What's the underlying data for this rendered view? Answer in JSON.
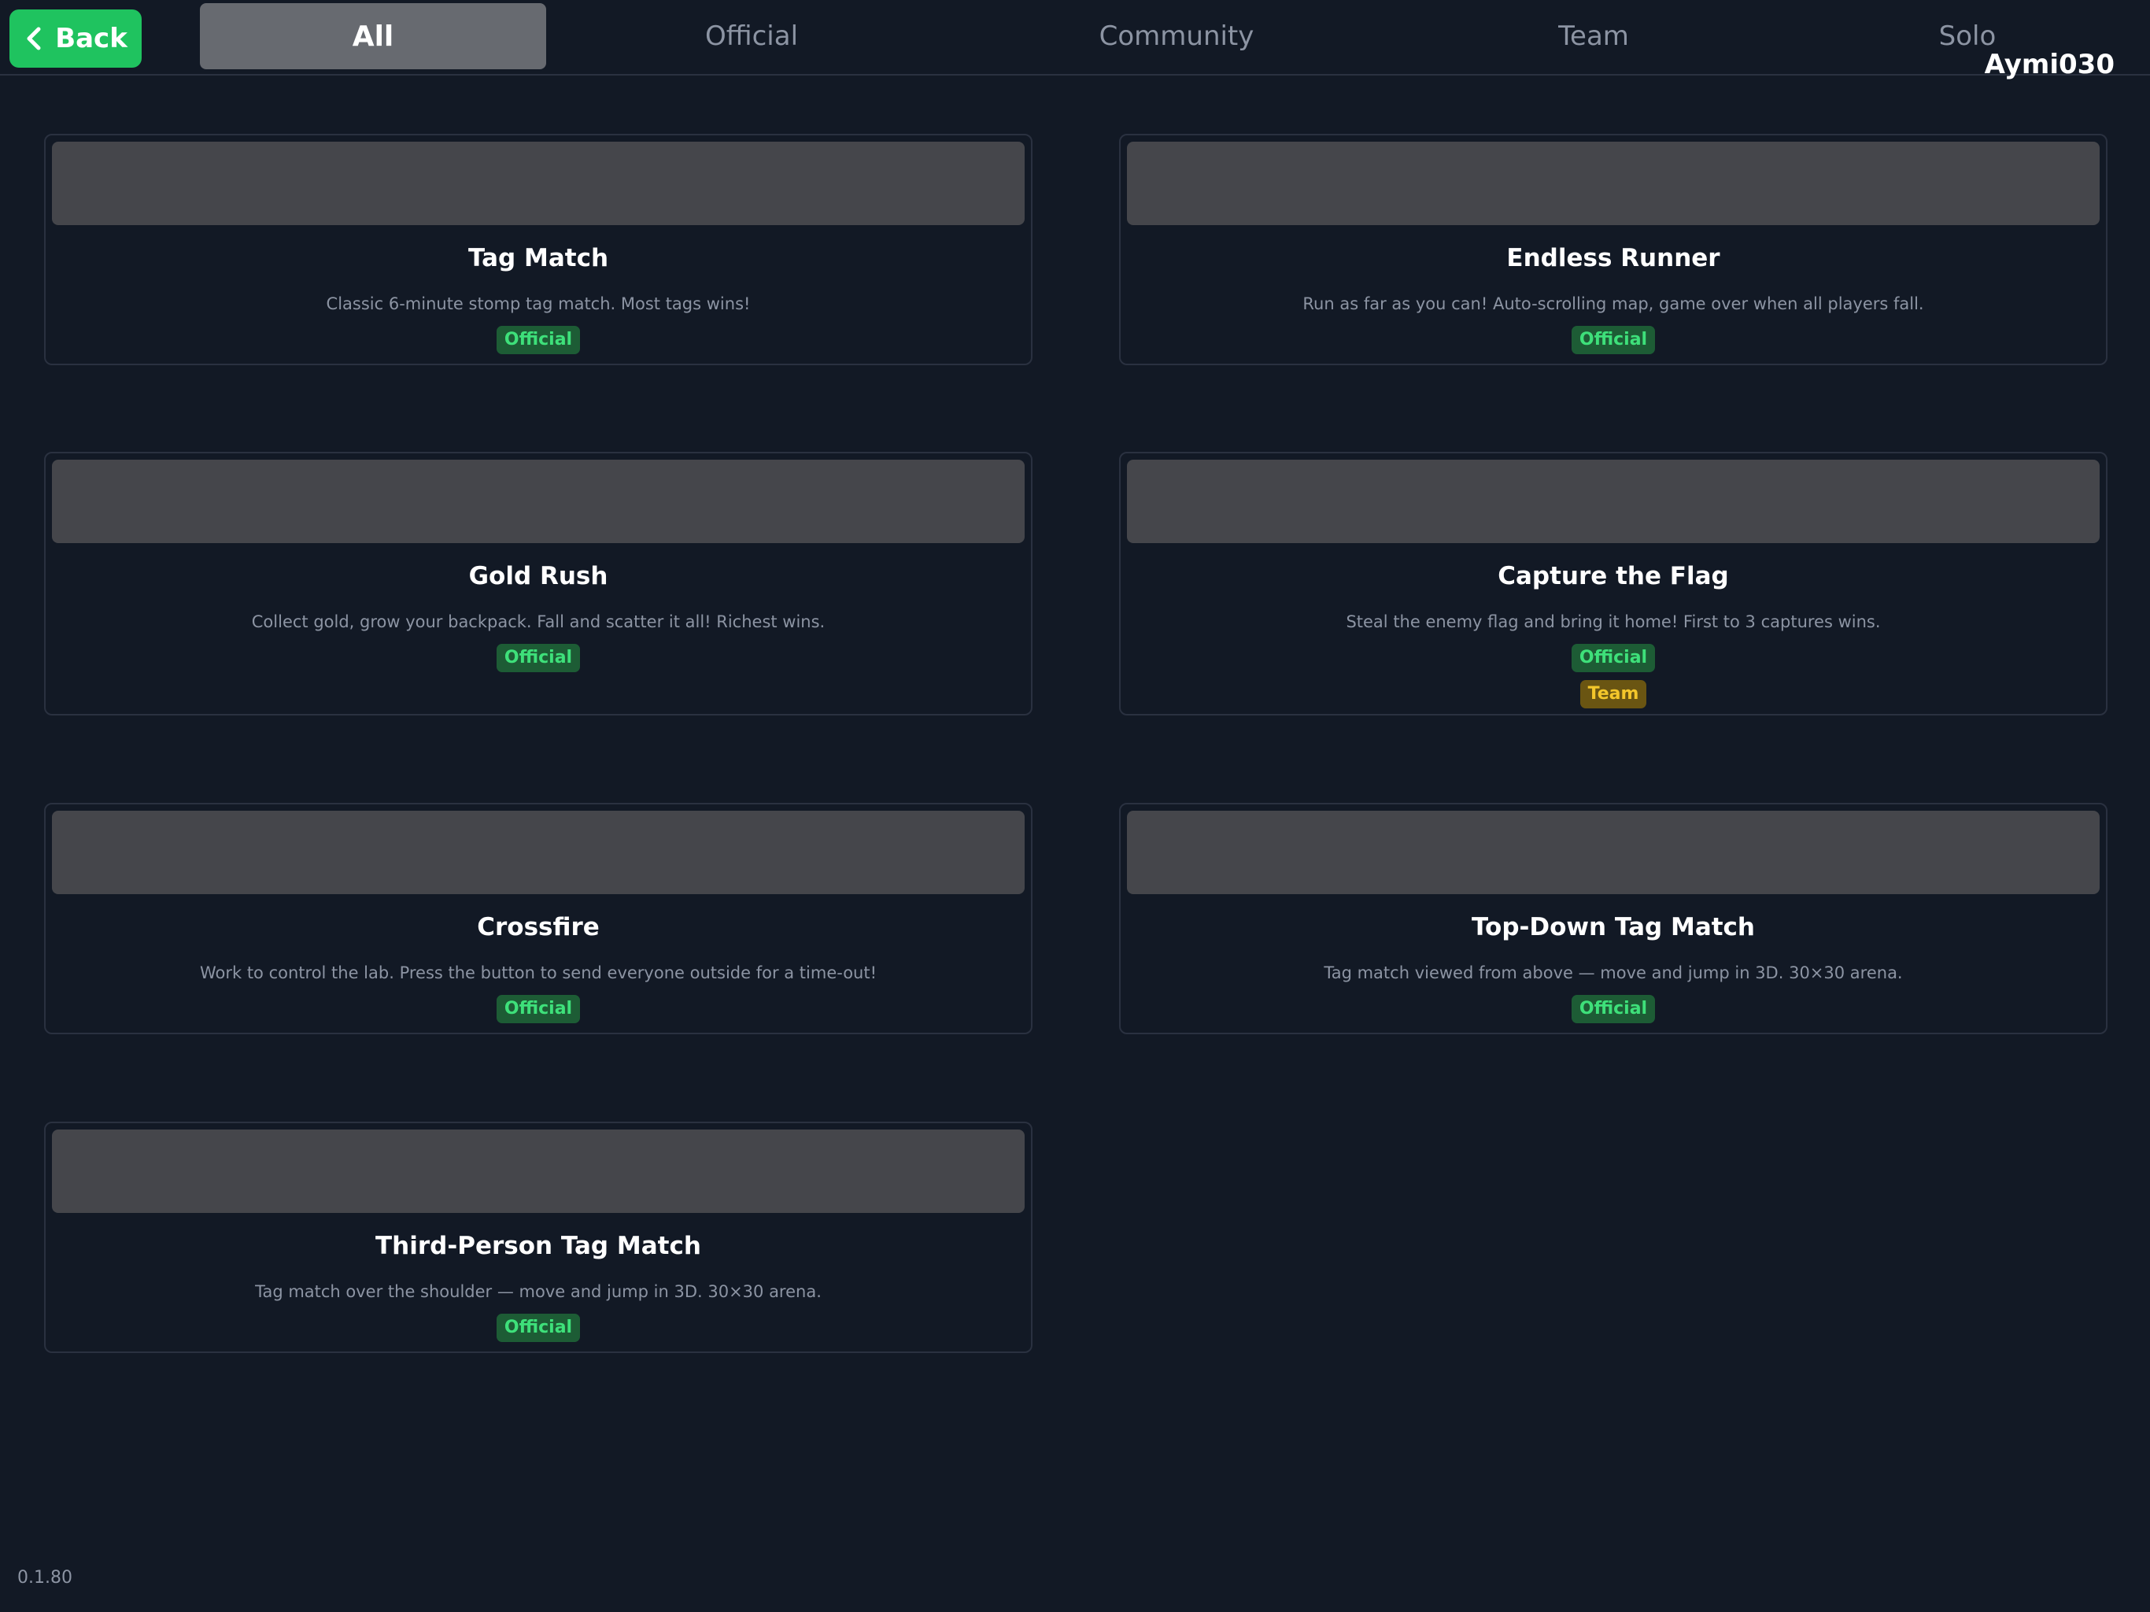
{
  "header": {
    "back_label": "Back",
    "username": "Aymi030",
    "tabs": [
      {
        "label": "All",
        "active": true
      },
      {
        "label": "Official",
        "active": false
      },
      {
        "label": "Community",
        "active": false
      },
      {
        "label": "Team",
        "active": false
      },
      {
        "label": "Solo",
        "active": false
      }
    ]
  },
  "games": [
    {
      "title": "Tag Match",
      "description": "Classic 6-minute stomp tag match. Most tags wins!",
      "badges": [
        "Official"
      ]
    },
    {
      "title": "Endless Runner",
      "description": "Run as far as you can! Auto-scrolling map, game over when all players fall.",
      "badges": [
        "Official"
      ]
    },
    {
      "title": "Gold Rush",
      "description": "Collect gold, grow your backpack. Fall and scatter it all! Richest wins.",
      "badges": [
        "Official"
      ]
    },
    {
      "title": "Capture the Flag",
      "description": "Steal the enemy flag and bring it home! First to 3 captures wins.",
      "badges": [
        "Official",
        "Team"
      ]
    },
    {
      "title": "Crossfire",
      "description": "Work to control the lab. Press the button to send everyone outside for a time-out!",
      "badges": [
        "Official"
      ]
    },
    {
      "title": "Top-Down Tag Match",
      "description": "Tag match viewed from above — move and jump in 3D. 30×30 arena.",
      "badges": [
        "Official"
      ]
    },
    {
      "title": "Third-Person Tag Match",
      "description": "Tag match over the shoulder — move and jump in 3D. 30×30 arena.",
      "badges": [
        "Official"
      ]
    }
  ],
  "colors": {
    "background": "#121925",
    "accent": "#1fc35f",
    "official_badge_bg": "#1d5c35",
    "official_badge_text": "#3ee07a",
    "team_badge_bg": "#6a5512",
    "team_badge_text": "#f3c62b"
  },
  "footer": {
    "version": "0.1.80"
  }
}
